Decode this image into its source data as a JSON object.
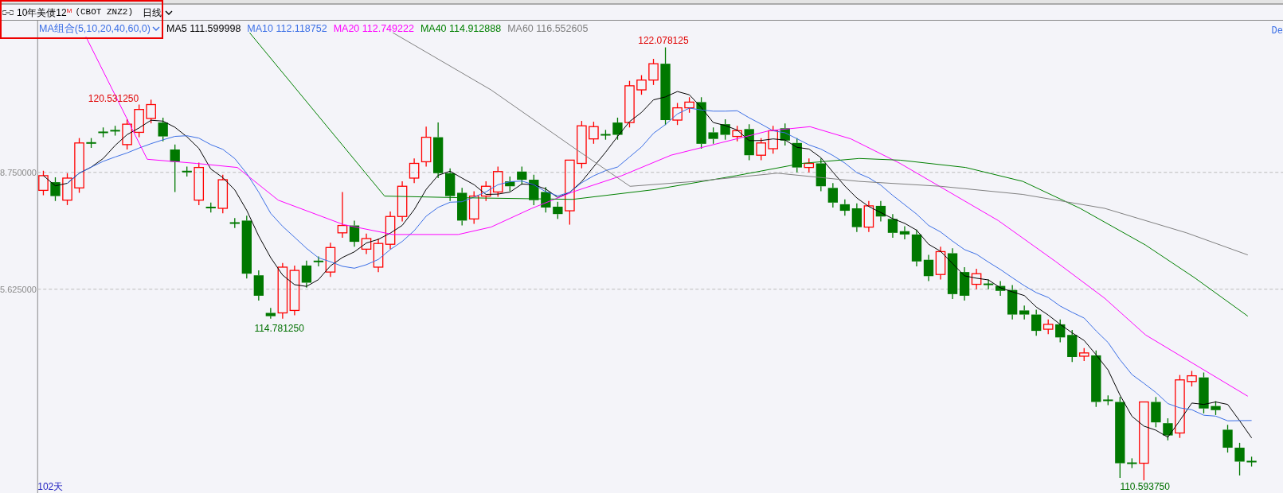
{
  "header": {
    "title": "10年美债12$^{M}$",
    "code": "(CBOT ZNZ2)",
    "period": "日线"
  },
  "indicator": {
    "label": "MA组合(5,10,20,40,60,0)",
    "lines": [
      {
        "name": "MA5",
        "value": "111.599998",
        "color": "#000000"
      },
      {
        "name": "MA10",
        "value": "112.118752",
        "color": "#3b6fe6"
      },
      {
        "name": "MA20",
        "value": "112.749222",
        "color": "#ff00ff"
      },
      {
        "name": "MA40",
        "value": "114.912888",
        "color": "#008000"
      },
      {
        "name": "MA60",
        "value": "116.552605",
        "color": "#808080"
      }
    ]
  },
  "right_label": "De",
  "chart": {
    "y_labels": [
      "8.750000",
      "5.625000"
    ],
    "price_marks": [
      {
        "text": "120.531250",
        "kind": "high"
      },
      {
        "text": "122.078125",
        "kind": "high"
      },
      {
        "text": "114.781250",
        "kind": "low"
      },
      {
        "text": "110.593750",
        "kind": "low"
      }
    ],
    "day_count": "102天"
  }
}
